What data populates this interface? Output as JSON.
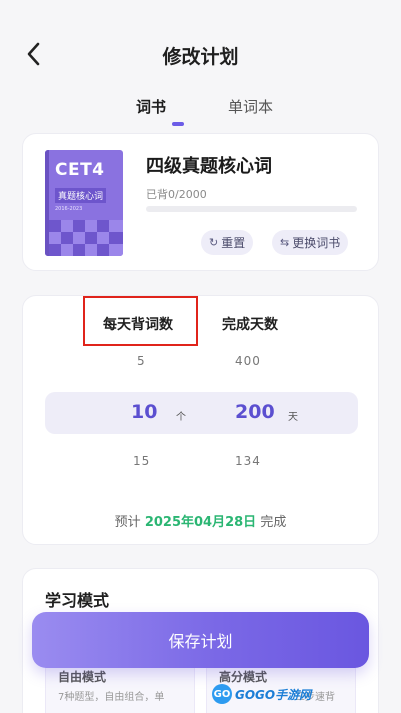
{
  "header": {
    "title": "修改计划",
    "back_icon": "chevron-left-icon"
  },
  "tabs": [
    {
      "label": "词书",
      "active": true
    },
    {
      "label": "单词本",
      "active": false
    }
  ],
  "book": {
    "cover_title": "CET4",
    "cover_subtitle": "真题核心词",
    "cover_years": "2016-2023",
    "name": "四级真题核心词",
    "progress_text": "已背0/2000",
    "progress": 0,
    "reset_label": "重置",
    "change_label": "更换词书"
  },
  "plan": {
    "daily_words_label": "每天背词数",
    "days_label": "完成天数",
    "words_options": {
      "above": "5",
      "selected": "10",
      "below": "15"
    },
    "days_options": {
      "above": "400",
      "selected": "200",
      "below": "134"
    },
    "words_unit": "个",
    "days_unit": "天",
    "estimate_prefix": "预计",
    "estimate_date": "2025年04月28日",
    "estimate_suffix": "完成"
  },
  "mode": {
    "title": "学习模式",
    "options": [
      {
        "name": "自由模式",
        "desc": "7种题型，自由组合，单"
      },
      {
        "name": "高分模式",
        "desc": "三步速背"
      }
    ]
  },
  "save_label": "保存计划",
  "watermark": {
    "logo": "GO",
    "text": "GOGO手游网"
  },
  "colors": {
    "accent": "#6c5ce7",
    "date_green": "#2bb673",
    "highlight_red": "#e0241b"
  }
}
